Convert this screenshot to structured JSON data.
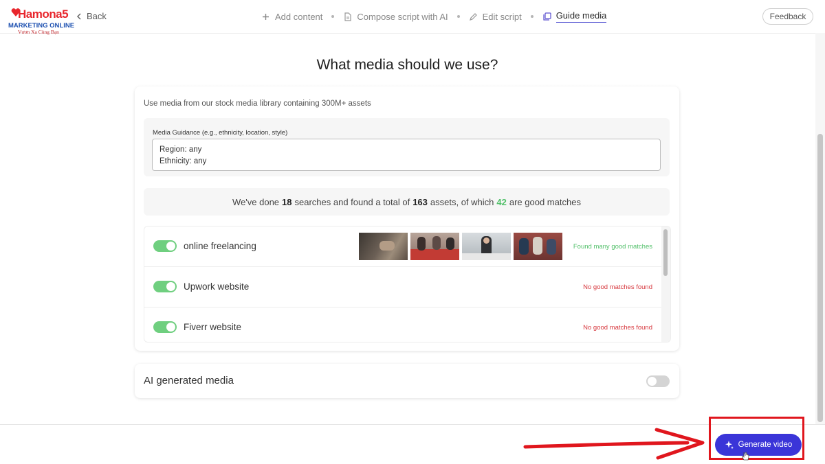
{
  "logo": {
    "brand": "Hamona5",
    "subtitle": "MARKETING ONLINE",
    "tagline": "Vươn Xa Cùng Bạn"
  },
  "nav": {
    "back_label": "Back",
    "steps": [
      {
        "label": "Add content",
        "icon": "plus-icon"
      },
      {
        "label": "Compose script with AI",
        "icon": "document-icon"
      },
      {
        "label": "Edit script",
        "icon": "pencil-icon"
      },
      {
        "label": "Guide media",
        "icon": "media-stack-icon",
        "active": true
      }
    ],
    "feedback_label": "Feedback"
  },
  "page": {
    "title": "What media should we use?"
  },
  "stock_media": {
    "description": "Use media from our stock media library containing 300M+ assets",
    "guidance_label": "Media Guidance (e.g., ethnicity, location, style)",
    "guidance_lines": [
      "Region: any",
      "Ethnicity: any"
    ],
    "summary": {
      "prefix": "We've done",
      "searches": "18",
      "middle": "searches and found a total of",
      "assets": "163",
      "suffix1": "assets, of which",
      "good": "42",
      "suffix2": "are good matches"
    },
    "searches": [
      {
        "label": "online freelancing",
        "enabled": true,
        "status": "Found many good matches",
        "good": true
      },
      {
        "label": "Upwork website",
        "enabled": true,
        "status": "No good matches found",
        "good": false
      },
      {
        "label": "Fiverr website",
        "enabled": true,
        "status": "No good matches found",
        "good": false
      }
    ]
  },
  "ai_media": {
    "label": "AI generated media",
    "enabled": false
  },
  "actions": {
    "generate_label": "Generate video"
  },
  "colors": {
    "accent": "#3a35d8",
    "toggle_on": "#6fcf7f",
    "good": "#52c06a",
    "bad": "#d6363c",
    "annotation": "#e0161d"
  }
}
